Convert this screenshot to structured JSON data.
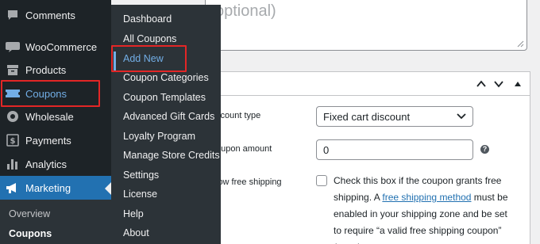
{
  "sidebar": {
    "items": [
      {
        "label": "Comments",
        "icon": "comment-icon"
      },
      {
        "label": "WooCommerce",
        "icon": "woocommerce-icon"
      },
      {
        "label": "Products",
        "icon": "archive-icon"
      },
      {
        "label": "Coupons",
        "icon": "ticket-icon"
      },
      {
        "label": "Wholesale",
        "icon": "wholesale-icon"
      },
      {
        "label": "Payments",
        "icon": "dollar-icon"
      },
      {
        "label": "Analytics",
        "icon": "bar-chart-icon"
      },
      {
        "label": "Marketing",
        "icon": "megaphone-icon"
      }
    ],
    "submenu": [
      {
        "label": "Overview"
      },
      {
        "label": "Coupons"
      }
    ]
  },
  "flyout": {
    "items": [
      {
        "label": "Dashboard"
      },
      {
        "label": "All Coupons"
      },
      {
        "label": "Add New"
      },
      {
        "label": "Coupon Categories"
      },
      {
        "label": "Coupon Templates"
      },
      {
        "label": "Advanced Gift Cards"
      },
      {
        "label": "Loyalty Program"
      },
      {
        "label": "Manage Store Credits"
      },
      {
        "label": "Settings"
      },
      {
        "label": "License"
      },
      {
        "label": "Help"
      },
      {
        "label": "About"
      }
    ]
  },
  "description": {
    "placeholder": "optional)"
  },
  "coupon_data": {
    "discount_type": {
      "label": "scount type",
      "value": "Fixed cart discount"
    },
    "coupon_amount": {
      "label": "oupon amount",
      "value": "0"
    },
    "free_shipping": {
      "label": "low free shipping",
      "text_before": "Check this box if the coupon grants free shipping. A ",
      "link": "free shipping method",
      "text_after": " must be enabled in your shipping zone and be set to require “a valid free shipping coupon” (see the"
    }
  },
  "colors": {
    "sidebar_bg": "#1d2327",
    "flyout_bg": "#2c3338",
    "accent": "#2271b1",
    "highlight": "#e32626"
  }
}
